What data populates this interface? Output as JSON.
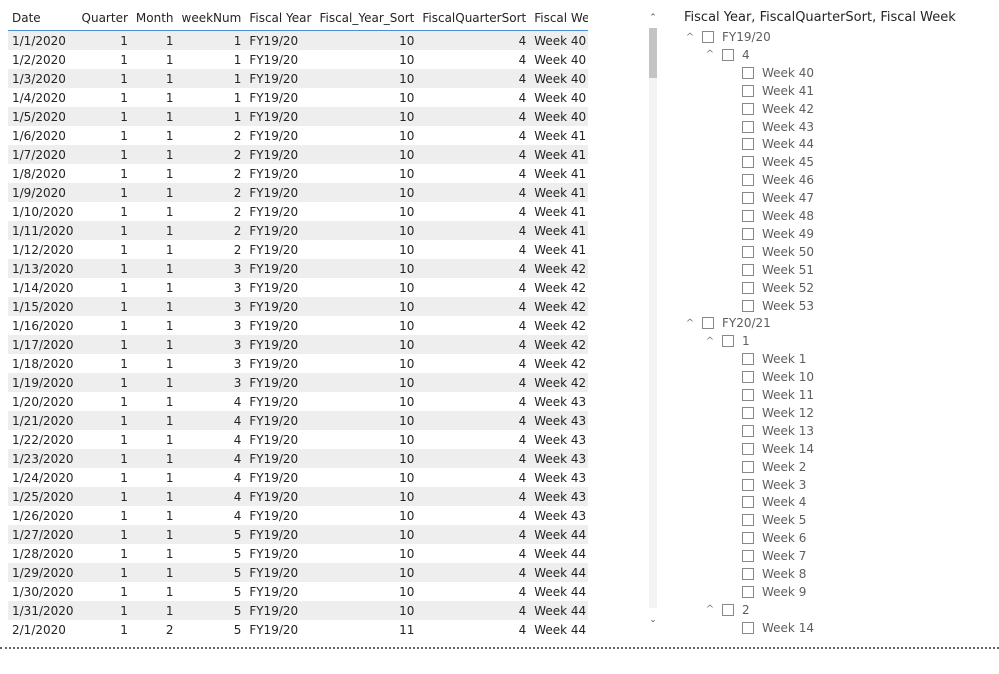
{
  "table": {
    "columns": [
      "Date",
      "Quarter",
      "Month",
      "weekNum",
      "Fiscal Year",
      "Fiscal_Year_Sort",
      "FiscalQuarterSort",
      "Fiscal Week"
    ],
    "rows": [
      [
        "1/1/2020",
        "1",
        "1",
        "1",
        "FY19/20",
        "10",
        "4",
        "Week 40"
      ],
      [
        "1/2/2020",
        "1",
        "1",
        "1",
        "FY19/20",
        "10",
        "4",
        "Week 40"
      ],
      [
        "1/3/2020",
        "1",
        "1",
        "1",
        "FY19/20",
        "10",
        "4",
        "Week 40"
      ],
      [
        "1/4/2020",
        "1",
        "1",
        "1",
        "FY19/20",
        "10",
        "4",
        "Week 40"
      ],
      [
        "1/5/2020",
        "1",
        "1",
        "1",
        "FY19/20",
        "10",
        "4",
        "Week 40"
      ],
      [
        "1/6/2020",
        "1",
        "1",
        "2",
        "FY19/20",
        "10",
        "4",
        "Week 41"
      ],
      [
        "1/7/2020",
        "1",
        "1",
        "2",
        "FY19/20",
        "10",
        "4",
        "Week 41"
      ],
      [
        "1/8/2020",
        "1",
        "1",
        "2",
        "FY19/20",
        "10",
        "4",
        "Week 41"
      ],
      [
        "1/9/2020",
        "1",
        "1",
        "2",
        "FY19/20",
        "10",
        "4",
        "Week 41"
      ],
      [
        "1/10/2020",
        "1",
        "1",
        "2",
        "FY19/20",
        "10",
        "4",
        "Week 41"
      ],
      [
        "1/11/2020",
        "1",
        "1",
        "2",
        "FY19/20",
        "10",
        "4",
        "Week 41"
      ],
      [
        "1/12/2020",
        "1",
        "1",
        "2",
        "FY19/20",
        "10",
        "4",
        "Week 41"
      ],
      [
        "1/13/2020",
        "1",
        "1",
        "3",
        "FY19/20",
        "10",
        "4",
        "Week 42"
      ],
      [
        "1/14/2020",
        "1",
        "1",
        "3",
        "FY19/20",
        "10",
        "4",
        "Week 42"
      ],
      [
        "1/15/2020",
        "1",
        "1",
        "3",
        "FY19/20",
        "10",
        "4",
        "Week 42"
      ],
      [
        "1/16/2020",
        "1",
        "1",
        "3",
        "FY19/20",
        "10",
        "4",
        "Week 42"
      ],
      [
        "1/17/2020",
        "1",
        "1",
        "3",
        "FY19/20",
        "10",
        "4",
        "Week 42"
      ],
      [
        "1/18/2020",
        "1",
        "1",
        "3",
        "FY19/20",
        "10",
        "4",
        "Week 42"
      ],
      [
        "1/19/2020",
        "1",
        "1",
        "3",
        "FY19/20",
        "10",
        "4",
        "Week 42"
      ],
      [
        "1/20/2020",
        "1",
        "1",
        "4",
        "FY19/20",
        "10",
        "4",
        "Week 43"
      ],
      [
        "1/21/2020",
        "1",
        "1",
        "4",
        "FY19/20",
        "10",
        "4",
        "Week 43"
      ],
      [
        "1/22/2020",
        "1",
        "1",
        "4",
        "FY19/20",
        "10",
        "4",
        "Week 43"
      ],
      [
        "1/23/2020",
        "1",
        "1",
        "4",
        "FY19/20",
        "10",
        "4",
        "Week 43"
      ],
      [
        "1/24/2020",
        "1",
        "1",
        "4",
        "FY19/20",
        "10",
        "4",
        "Week 43"
      ],
      [
        "1/25/2020",
        "1",
        "1",
        "4",
        "FY19/20",
        "10",
        "4",
        "Week 43"
      ],
      [
        "1/26/2020",
        "1",
        "1",
        "4",
        "FY19/20",
        "10",
        "4",
        "Week 43"
      ],
      [
        "1/27/2020",
        "1",
        "1",
        "5",
        "FY19/20",
        "10",
        "4",
        "Week 44"
      ],
      [
        "1/28/2020",
        "1",
        "1",
        "5",
        "FY19/20",
        "10",
        "4",
        "Week 44"
      ],
      [
        "1/29/2020",
        "1",
        "1",
        "5",
        "FY19/20",
        "10",
        "4",
        "Week 44"
      ],
      [
        "1/30/2020",
        "1",
        "1",
        "5",
        "FY19/20",
        "10",
        "4",
        "Week 44"
      ],
      [
        "1/31/2020",
        "1",
        "1",
        "5",
        "FY19/20",
        "10",
        "4",
        "Week 44"
      ],
      [
        "2/1/2020",
        "1",
        "2",
        "5",
        "FY19/20",
        "11",
        "4",
        "Week 44"
      ]
    ]
  },
  "slicer": {
    "title": "Fiscal Year, FiscalQuarterSort, Fiscal Week",
    "nodes": [
      {
        "level": 0,
        "label": "FY19/20",
        "expanded": true
      },
      {
        "level": 1,
        "label": "4",
        "expanded": true
      },
      {
        "level": 2,
        "label": "Week 40"
      },
      {
        "level": 2,
        "label": "Week 41"
      },
      {
        "level": 2,
        "label": "Week 42"
      },
      {
        "level": 2,
        "label": "Week 43"
      },
      {
        "level": 2,
        "label": "Week 44"
      },
      {
        "level": 2,
        "label": "Week 45"
      },
      {
        "level": 2,
        "label": "Week 46"
      },
      {
        "level": 2,
        "label": "Week 47"
      },
      {
        "level": 2,
        "label": "Week 48"
      },
      {
        "level": 2,
        "label": "Week 49"
      },
      {
        "level": 2,
        "label": "Week 50"
      },
      {
        "level": 2,
        "label": "Week 51"
      },
      {
        "level": 2,
        "label": "Week 52"
      },
      {
        "level": 2,
        "label": "Week 53"
      },
      {
        "level": 0,
        "label": "FY20/21",
        "expanded": true
      },
      {
        "level": 1,
        "label": "1",
        "expanded": true
      },
      {
        "level": 2,
        "label": "Week 1"
      },
      {
        "level": 2,
        "label": "Week 10"
      },
      {
        "level": 2,
        "label": "Week 11"
      },
      {
        "level": 2,
        "label": "Week 12"
      },
      {
        "level": 2,
        "label": "Week 13"
      },
      {
        "level": 2,
        "label": "Week 14"
      },
      {
        "level": 2,
        "label": "Week 2"
      },
      {
        "level": 2,
        "label": "Week 3"
      },
      {
        "level": 2,
        "label": "Week 4"
      },
      {
        "level": 2,
        "label": "Week 5"
      },
      {
        "level": 2,
        "label": "Week 6"
      },
      {
        "level": 2,
        "label": "Week 7"
      },
      {
        "level": 2,
        "label": "Week 8"
      },
      {
        "level": 2,
        "label": "Week 9"
      },
      {
        "level": 1,
        "label": "2",
        "expanded": true
      },
      {
        "level": 2,
        "label": "Week 14"
      }
    ]
  },
  "scrollbar": {
    "up_icon": "chevron-up-icon",
    "down_icon": "chevron-down-icon"
  },
  "colors": {
    "header_underline": "#4a90d9",
    "row_stripe": "#eeeeee",
    "text": "#252423"
  }
}
